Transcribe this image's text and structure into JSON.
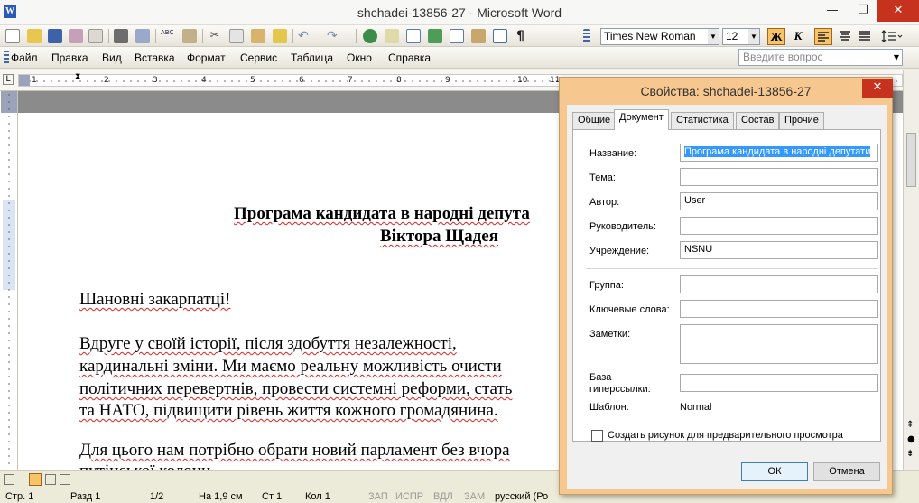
{
  "window": {
    "title": "shchadei-13856-27 - Microsoft Word",
    "controls": {
      "minimize": "—",
      "maximize": "❐",
      "close": "✕"
    }
  },
  "formatting": {
    "font_name": "Times New Roman",
    "font_size": "12",
    "bold": "Ж",
    "italic": "К"
  },
  "menu": {
    "items": [
      "Файл",
      "Правка",
      "Вид",
      "Вставка",
      "Формат",
      "Сервис",
      "Таблица",
      "Окно",
      "Справка"
    ],
    "help_placeholder": "Введите вопрос"
  },
  "ruler": {
    "numbers": [
      "1",
      "2",
      "3",
      "4",
      "5",
      "6",
      "7",
      "8",
      "9",
      "10",
      "11"
    ]
  },
  "document": {
    "title_line1": "Програма кандидата в народні депута",
    "title_line2": "Віктора Щадея",
    "greeting": "Шановні закарпатці!",
    "para1": [
      "Вдруге  у  своїй  історії,  після  здобуття  незалежності,",
      "кардинальні зміни. Ми маємо реальну можливість очисти",
      "політичних перевертнів, провести системні реформи, стать",
      "та НАТО, підвищити рівень життя кожного громадянина."
    ],
    "para2": [
      "Для цього нам потрібно обрати новий парламент без вчора",
      "путінської колони"
    ]
  },
  "statusbar": {
    "page": "Стр. 1",
    "section": "Разд 1",
    "pages": "1/2",
    "at": "На 1,9 см",
    "line": "Ст 1",
    "col": "Кол 1",
    "rec": "ЗАП",
    "trk": "ИСПР",
    "ext": "ВДЛ",
    "ovr": "ЗАМ",
    "language": "русский (Ро"
  },
  "dialog": {
    "title": "Свойства: shchadei-13856-27",
    "close": "✕",
    "tabs": [
      "Общие",
      "Документ",
      "Статистика",
      "Состав",
      "Прочие"
    ],
    "active_tab": "Документ",
    "fields": {
      "title_label": "Название:",
      "title_value": "Програма кандидата в народні депутати",
      "subject_label": "Тема:",
      "subject_value": "",
      "author_label": "Автор:",
      "author_value": "User",
      "manager_label": "Руководитель:",
      "manager_value": "",
      "company_label": "Учреждение:",
      "company_value": "NSNU",
      "category_label": "Группа:",
      "category_value": "",
      "keywords_label": "Ключевые слова:",
      "keywords_value": "",
      "comments_label": "Заметки:",
      "comments_value": "",
      "hyperlink_label_1": "База",
      "hyperlink_label_2": "гиперссылки:",
      "hyperlink_value": "",
      "template_label": "Шаблон:",
      "template_value": "Normal"
    },
    "preview_checkbox": "Создать рисунок для предварительного просмотра",
    "ok": "ОК",
    "cancel": "Отмена"
  },
  "colors": {
    "dialog_frame": "#f6c78f",
    "close_red": "#c7321e",
    "selection_blue": "#3399ff",
    "spellcheck_red": "#d22222"
  }
}
